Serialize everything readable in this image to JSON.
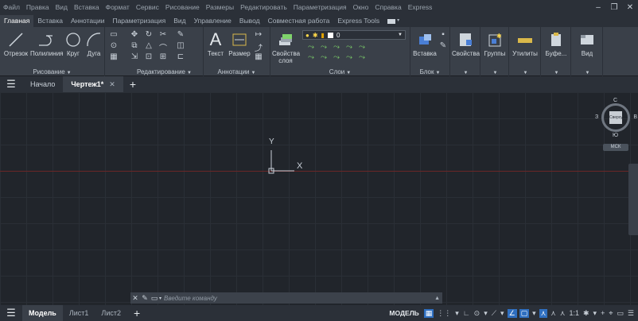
{
  "menu": [
    "Файл",
    "Правка",
    "Вид",
    "Вставка",
    "Формат",
    "Сервис",
    "Рисование",
    "Размеры",
    "Редактировать",
    "Параметризация",
    "Окно",
    "Справка",
    "Express"
  ],
  "window_controls": [
    "–",
    "❐",
    "✕"
  ],
  "ribbon_tabs": [
    "Главная",
    "Вставка",
    "Аннотации",
    "Параметризация",
    "Вид",
    "Управление",
    "Вывод",
    "Совместная работа",
    "Express Tools"
  ],
  "ribbon": {
    "draw": {
      "title": "Рисование",
      "line": "Отрезок",
      "polyline": "Полилиния",
      "circle": "Круг",
      "arc": "Дуга"
    },
    "modify": {
      "title": "Редактирование"
    },
    "annot": {
      "title": "Аннотации",
      "text": "Текст",
      "dim": "Размер"
    },
    "layers": {
      "title": "Слои",
      "props": "Свойства",
      "props2": "слоя",
      "layer_value": "0"
    },
    "block": {
      "title": "Блок",
      "insert": "Вставка"
    },
    "props": {
      "label": "Свойства"
    },
    "groups": {
      "label": "Группы"
    },
    "utils": {
      "label": "Утилиты"
    },
    "clip": {
      "label": "Буфе..."
    },
    "view": {
      "label": "Вид"
    }
  },
  "file_tabs": {
    "start": "Начало",
    "drawing": "Чертеж1*"
  },
  "canvas": {
    "ucs_y": "Y",
    "ucs_x": "X"
  },
  "viewcube": {
    "n": "С",
    "s": "Ю",
    "w": "З",
    "e": "В",
    "face": "Сверху",
    "wcs": "МСК"
  },
  "command": {
    "placeholder": "Введите команду"
  },
  "layout_tabs": [
    "Модель",
    "Лист1",
    "Лист2"
  ],
  "status": {
    "model": "МОДЕЛЬ",
    "scale": "1:1"
  }
}
